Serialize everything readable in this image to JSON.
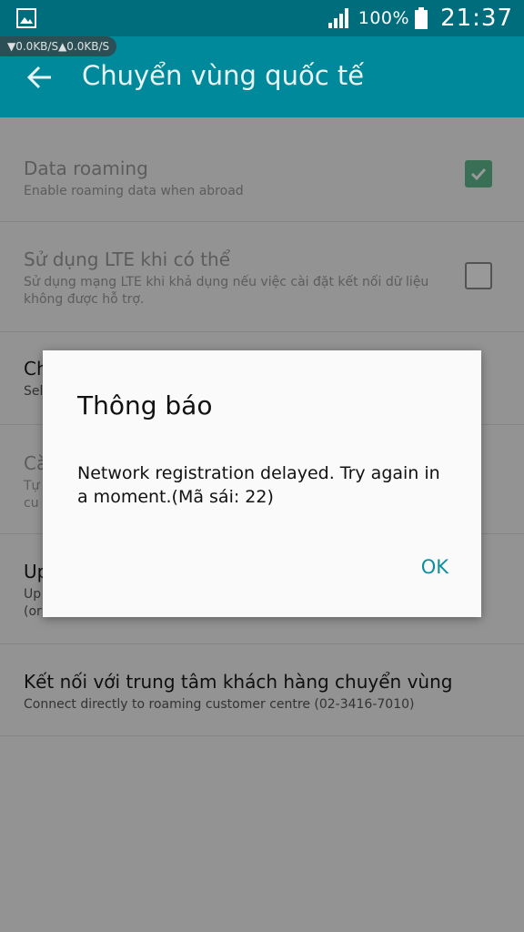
{
  "status_bar": {
    "net_speed": "▼0.0KB/S▲0.0KB/S",
    "battery_percent": "100%",
    "time": "21:37"
  },
  "app_bar": {
    "title": "Chuyển vùng quốc tế"
  },
  "settings": [
    {
      "title": "Data roaming",
      "subtitle": "Enable roaming data when abroad",
      "checked": true,
      "disabled": true
    },
    {
      "title": "Sử dụng LTE khi có thể",
      "subtitle": "Sử dụng mạng LTE khi khả dụng nếu việc cài đặt kết nối dữ liệu không được hỗ trợ.",
      "checked": false,
      "disabled": true
    },
    {
      "title": "Ch",
      "subtitle": "Sel"
    },
    {
      "title": "Cà",
      "subtitle": "Tự\ncu",
      "disabled": true
    },
    {
      "title": "Up",
      "subtitle": "Up\n(or"
    },
    {
      "title": "Kết nối với trung tâm khách hàng chuyển vùng",
      "subtitle": "Connect directly to roaming customer centre (02-3416-7010)"
    }
  ],
  "dialog": {
    "title": "Thông báo",
    "message": "Network registration delayed. Try again in a moment.(Mã sái: 22)",
    "ok_label": "OK"
  },
  "colors": {
    "status_bar": "#006d7d",
    "app_bar": "#00899a",
    "accent": "#0d8fa0",
    "checkbox_checked": "#5fb98c"
  }
}
